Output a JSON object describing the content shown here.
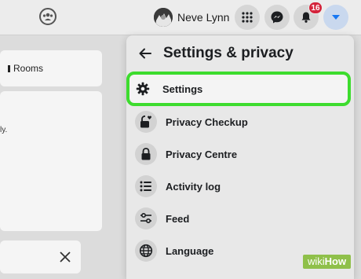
{
  "topbar": {
    "profile_name": "Neve Lynn",
    "notification_count": "16"
  },
  "background": {
    "rooms_label": "Rooms",
    "post_snippet": "ly."
  },
  "panel": {
    "title": "Settings & privacy",
    "items": [
      {
        "label": "Settings",
        "icon": "gear-icon"
      },
      {
        "label": "Privacy Checkup",
        "icon": "lock-heart-icon"
      },
      {
        "label": "Privacy Centre",
        "icon": "lock-icon"
      },
      {
        "label": "Activity log",
        "icon": "list-icon"
      },
      {
        "label": "Feed",
        "icon": "sliders-icon"
      },
      {
        "label": "Language",
        "icon": "globe-icon"
      }
    ]
  },
  "watermark": {
    "prefix": "wiki",
    "suffix": "How"
  },
  "colors": {
    "highlight": "#3ddc2e",
    "badge": "#d4243b",
    "accent": "#1877f2"
  }
}
